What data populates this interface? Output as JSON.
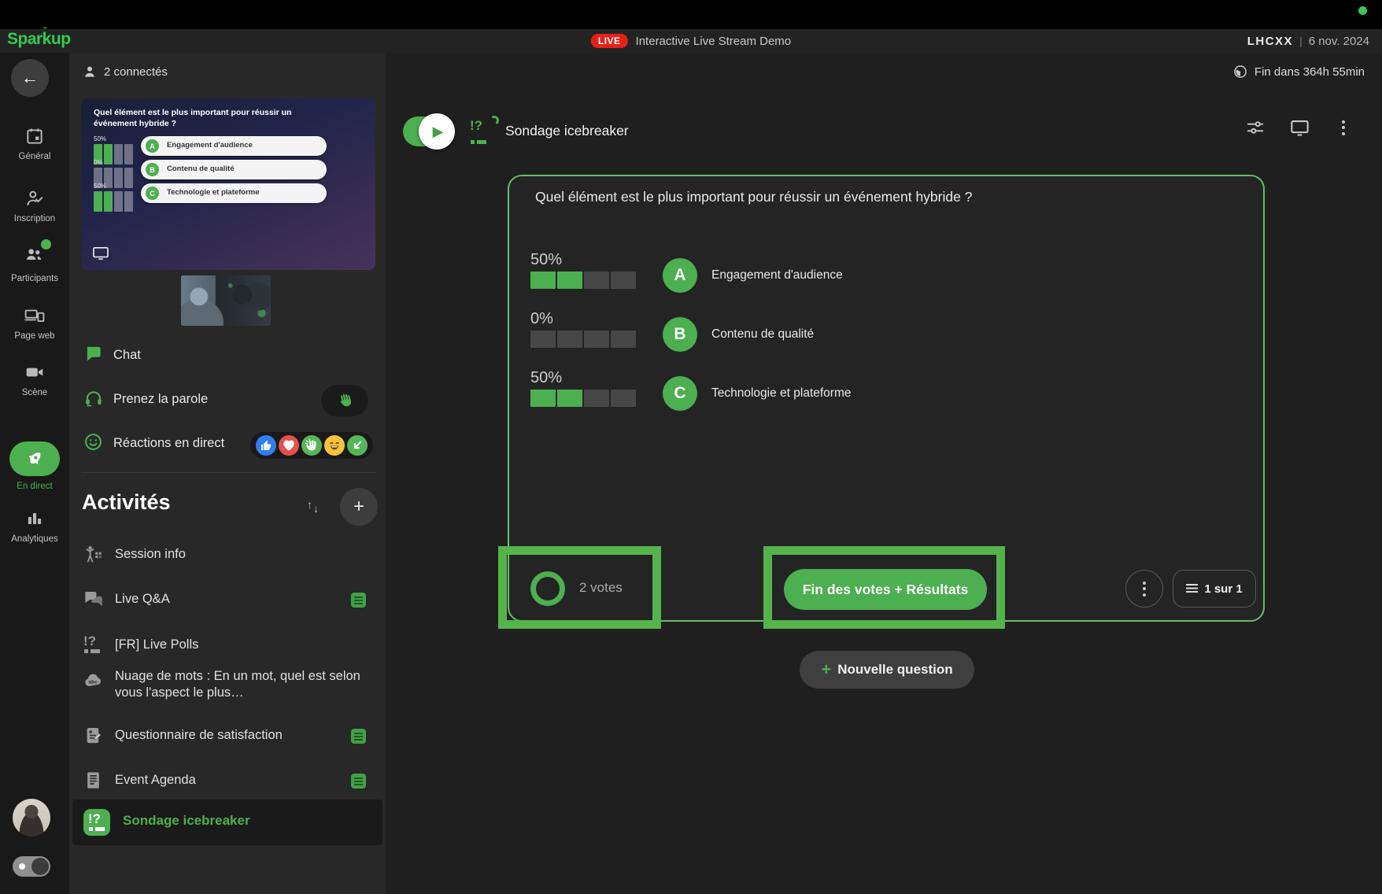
{
  "colors": {
    "accent": "#4caf50",
    "live_red": "#e62117",
    "annotation": "#55b34b",
    "presence": "#35c759"
  },
  "top_bar": {
    "logo": "Sparkup",
    "live_badge": "LIVE",
    "stream_title": "Interactive Live Stream Demo",
    "event_code": "LHCXX",
    "separator": "|",
    "event_date": "6 nov. 2024"
  },
  "session_bar": {
    "connected": "2 connectés",
    "time_remaining": "Fin dans 364h 55min"
  },
  "nav": {
    "active": "En direct",
    "items": [
      {
        "id": "general",
        "label": "Général",
        "icon": "calendar-icon"
      },
      {
        "id": "inscription",
        "label": "Inscription",
        "icon": "person-check-icon"
      },
      {
        "id": "participants",
        "label": "Participants",
        "icon": "people-icon"
      },
      {
        "id": "page-web",
        "label": "Page web",
        "icon": "devices-icon"
      },
      {
        "id": "scene",
        "label": "Scène",
        "icon": "videocam-icon"
      },
      {
        "id": "en-direct",
        "label": "En direct",
        "icon": "rocket-icon"
      },
      {
        "id": "analytiques",
        "label": "Analytiques",
        "icon": "bar-chart-icon"
      }
    ]
  },
  "stage_preview": {
    "question": "Quel élément est le plus important pour réussir un événement hybride ?",
    "options": [
      {
        "letter": "A",
        "label": "Engagement d'audience",
        "pct": "50%",
        "pct_value": 50
      },
      {
        "letter": "B",
        "label": "Contenu de qualité",
        "pct": "0%",
        "pct_value": 0
      },
      {
        "letter": "C",
        "label": "Technologie et plateforme",
        "pct": "50%",
        "pct_value": 50
      }
    ]
  },
  "panel": {
    "chat": "Chat",
    "speak": "Prenez la parole",
    "reactions": "Réactions en direct",
    "reaction_icons": [
      "thumbs-up",
      "heart",
      "clap",
      "laugh",
      "arrow-down-left"
    ]
  },
  "activities": {
    "title": "Activités",
    "items": [
      {
        "label": "Session info",
        "icon": "session-info-icon",
        "badge": false
      },
      {
        "label": "Live Q&A",
        "icon": "qa-bubbles-icon",
        "badge": true
      },
      {
        "label": "[FR] Live Polls",
        "icon": "poll-icon",
        "badge": false
      },
      {
        "label": "Nuage de mots : En un mot, quel est selon vous l'aspect le plus…",
        "icon": "word-cloud-icon",
        "badge": false
      },
      {
        "label": "Questionnaire de satisfaction",
        "icon": "survey-icon",
        "badge": true
      },
      {
        "label": "Event Agenda",
        "icon": "agenda-icon",
        "badge": true
      },
      {
        "label": "Sondage icebreaker",
        "icon": "poll-icon",
        "badge": false,
        "active": true
      }
    ]
  },
  "poll_view": {
    "title": "Sondage icebreaker",
    "question": "Quel élément est le plus important pour réussir un événement hybride ?",
    "options": [
      {
        "letter": "A",
        "label": "Engagement d'audience",
        "pct": "50%",
        "pct_value": 50
      },
      {
        "letter": "B",
        "label": "Contenu de qualité",
        "pct": "0%",
        "pct_value": 0
      },
      {
        "letter": "C",
        "label": "Technologie et plateforme",
        "pct": "50%",
        "pct_value": 50
      }
    ],
    "votes": "2 votes",
    "end_votes_button": "Fin des votes + Résultats",
    "pagination": "1 sur 1",
    "plus_sign": "+",
    "new_question": "Nouvelle question"
  },
  "chart_data": {
    "type": "bar",
    "title": "Quel élément est le plus important pour réussir un événement hybride ?",
    "categories": [
      "Engagement d'audience",
      "Contenu de qualité",
      "Technologie et plateforme"
    ],
    "values": [
      50,
      0,
      50
    ],
    "unit": "%",
    "total_votes": 2,
    "segments_per_bar": 4
  }
}
